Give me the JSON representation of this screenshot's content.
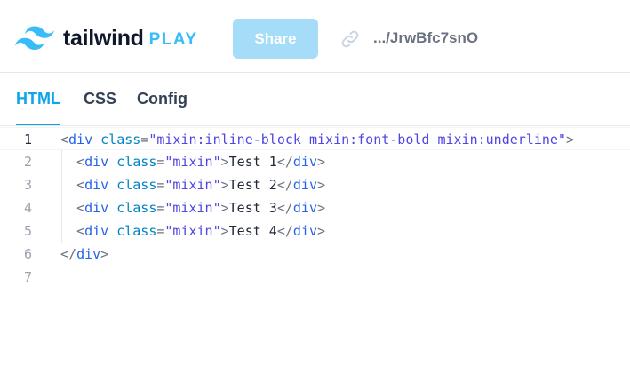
{
  "header": {
    "logo_word": "tailwind",
    "logo_play": "PLAY",
    "share_label": "Share",
    "short_url": ".../JrwBfc7snO",
    "logo_icon": "tailwind-wave-icon",
    "link_icon": "link-icon"
  },
  "tabs": [
    {
      "label": "HTML",
      "active": true
    },
    {
      "label": "CSS",
      "active": false
    },
    {
      "label": "Config",
      "active": false
    }
  ],
  "editor": {
    "current_line": 1,
    "line_numbers": [
      "1",
      "2",
      "3",
      "4",
      "5",
      "6",
      "7"
    ],
    "lines": [
      {
        "indent": "",
        "open": "<",
        "tag": "div",
        "attr": "class",
        "eq": "=",
        "value": "\"mixin:inline-block mixin:font-bold mixin:underline\"",
        "close": ">",
        "text": "",
        "end_open": "",
        "end_tag": "",
        "end_close": ""
      },
      {
        "indent": "  ",
        "open": "<",
        "tag": "div",
        "attr": "class",
        "eq": "=",
        "value": "\"mixin\"",
        "close": ">",
        "text": "Test 1",
        "end_open": "</",
        "end_tag": "div",
        "end_close": ">"
      },
      {
        "indent": "  ",
        "open": "<",
        "tag": "div",
        "attr": "class",
        "eq": "=",
        "value": "\"mixin\"",
        "close": ">",
        "text": "Test 2",
        "end_open": "</",
        "end_tag": "div",
        "end_close": ">"
      },
      {
        "indent": "  ",
        "open": "<",
        "tag": "div",
        "attr": "class",
        "eq": "=",
        "value": "\"mixin\"",
        "close": ">",
        "text": "Test 3",
        "end_open": "</",
        "end_tag": "div",
        "end_close": ">"
      },
      {
        "indent": "  ",
        "open": "<",
        "tag": "div",
        "attr": "class",
        "eq": "=",
        "value": "\"mixin\"",
        "close": ">",
        "text": "Test 4",
        "end_open": "</",
        "end_tag": "div",
        "end_close": ">"
      },
      {
        "indent": "",
        "open": "",
        "tag": "",
        "attr": "",
        "eq": "",
        "value": "",
        "close": "",
        "text": "",
        "end_open": "</",
        "end_tag": "div",
        "end_close": ">"
      },
      {
        "indent": "",
        "open": "",
        "tag": "",
        "attr": "",
        "eq": "",
        "value": "",
        "close": "",
        "text": "",
        "end_open": "",
        "end_tag": "",
        "end_close": ""
      }
    ]
  },
  "colors": {
    "accent": "#0ea5e9",
    "logo_accent": "#38bdf8",
    "share_button": "#a5dcf7"
  }
}
